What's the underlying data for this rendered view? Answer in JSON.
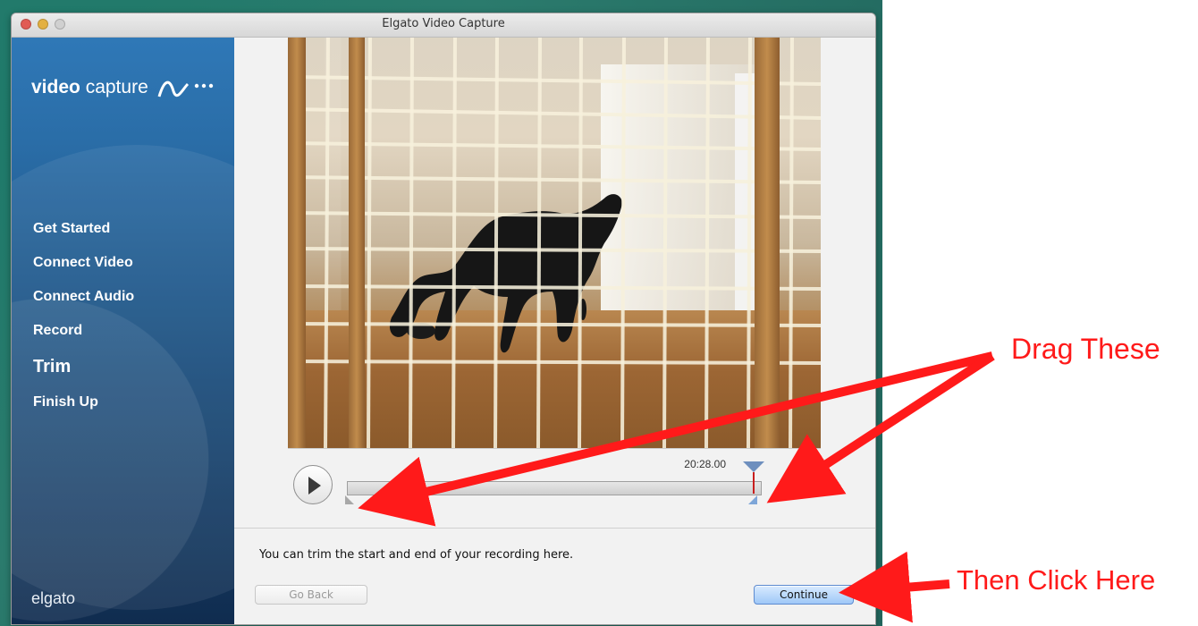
{
  "window": {
    "title": "Elgato Video Capture"
  },
  "sidebar": {
    "logo": {
      "strong": "video",
      "light": "capture"
    },
    "items": [
      {
        "label": "Get Started"
      },
      {
        "label": "Connect Video"
      },
      {
        "label": "Connect Audio"
      },
      {
        "label": "Record"
      },
      {
        "label": "Trim"
      },
      {
        "label": "Finish Up"
      }
    ],
    "brand": "elgato",
    "active_item": "Trim"
  },
  "player": {
    "time_display": "20:28.00",
    "icons": {
      "play": "play-icon",
      "start_trim": "trim-start-handle-icon",
      "end_trim": "trim-end-handle-icon",
      "playhead": "playhead-icon"
    }
  },
  "content": {
    "instruction": "You can trim the start and end of your recording here."
  },
  "buttons": {
    "go_back": "Go Back",
    "continue": "Continue"
  },
  "annotations": {
    "drag": "Drag These",
    "click": "Then Click Here"
  },
  "colors": {
    "sidebar_blue": "#2a6da7",
    "annotation_red": "#ff1a1a",
    "continue_blue": "#9fc8f7"
  }
}
